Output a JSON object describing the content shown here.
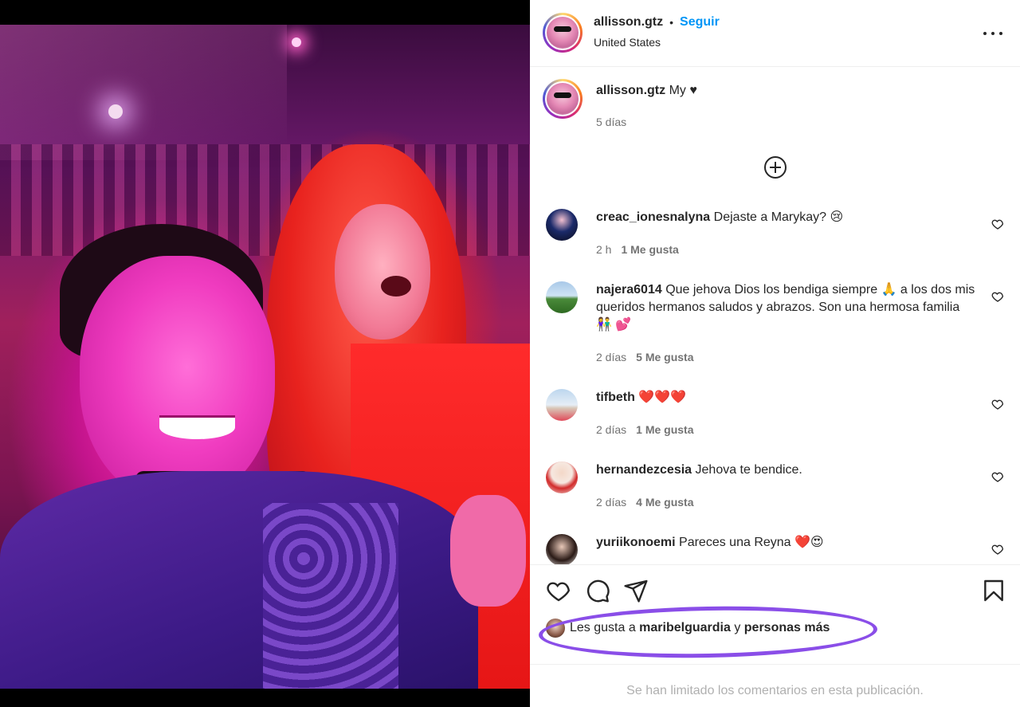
{
  "post": {
    "author": "allisson.gtz",
    "follow_label": "Seguir",
    "separator": "•",
    "location": "United States",
    "caption_user": "allisson.gtz",
    "caption_text": "My ♥",
    "caption_time": "5 días"
  },
  "comments": [
    {
      "user": "creac_ionesnalyna",
      "text": "Dejaste a Marykay? 😢",
      "time": "2 h",
      "likes": "1 Me gusta"
    },
    {
      "user": "najera6014",
      "text": "Que jehova Dios los bendiga siempre 🙏 a los dos mis queridos hermanos saludos y abrazos. Son una hermosa familia 👫 💕",
      "time": "2 días",
      "likes": "5 Me gusta"
    },
    {
      "user": "tifbeth",
      "text": "❤️❤️❤️",
      "time": "2 días",
      "likes": "1 Me gusta"
    },
    {
      "user": "hernandezcesia",
      "text": "Jehova te bendice.",
      "time": "2 días",
      "likes": "4 Me gusta"
    },
    {
      "user": "yuriikonoemi",
      "text": "Pareces una Reyna ❤️😍",
      "time": "",
      "likes": ""
    }
  ],
  "liked_by": {
    "prefix": "Les gusta a ",
    "user": "maribelguardia",
    "middle": " y ",
    "suffix": "personas más"
  },
  "footer": "Se han limitado los comentarios en esta publicación.",
  "icons": [
    "more-icon",
    "add-circle-icon",
    "heart-icon",
    "comment-icon",
    "share-icon",
    "bookmark-icon"
  ],
  "colors": {
    "link": "#0095f6",
    "highlight": "#8a4ee8",
    "muted": "#737373"
  }
}
